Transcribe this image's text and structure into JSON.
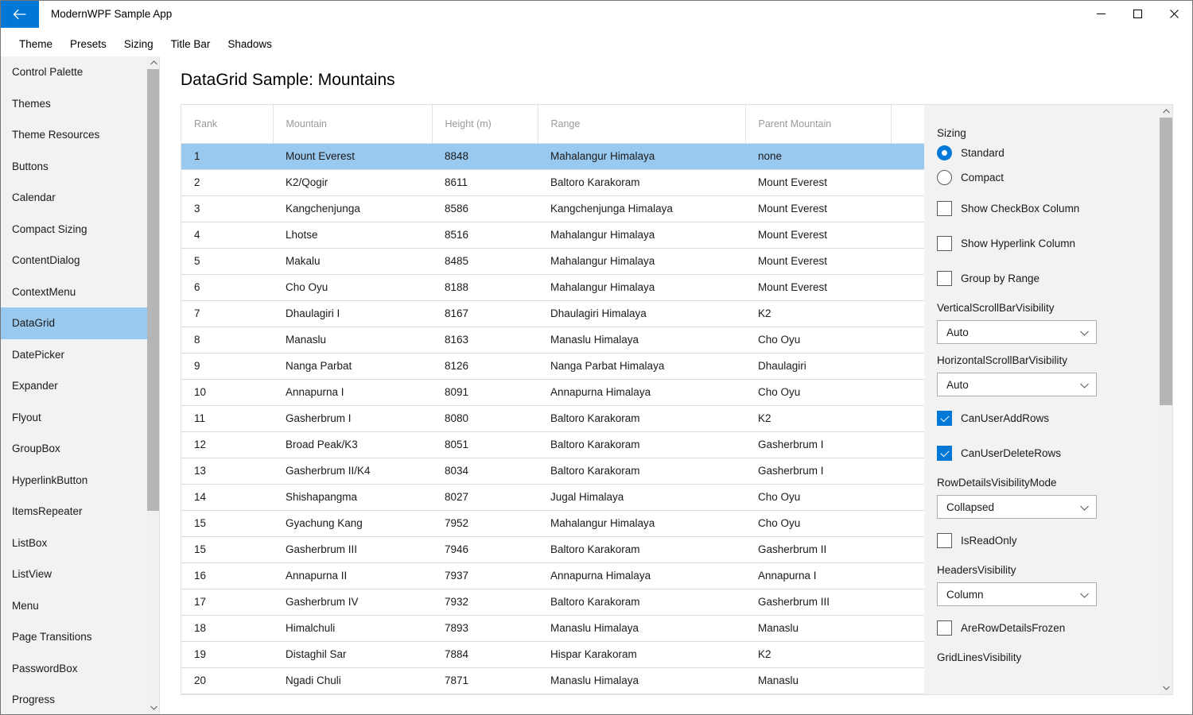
{
  "window": {
    "app_title": "ModernWPF Sample App",
    "back_icon": "back-arrow-icon",
    "minimize_label": "—",
    "maximize_label": "☐",
    "close_label": "✕"
  },
  "menubar": {
    "items": [
      {
        "label": "Theme"
      },
      {
        "label": "Presets"
      },
      {
        "label": "Sizing"
      },
      {
        "label": "Title Bar"
      },
      {
        "label": "Shadows"
      }
    ]
  },
  "sidebar": {
    "items": [
      {
        "label": "Control Palette",
        "selected": false
      },
      {
        "label": "Themes",
        "selected": false
      },
      {
        "label": "Theme Resources",
        "selected": false
      },
      {
        "label": "Buttons",
        "selected": false
      },
      {
        "label": "Calendar",
        "selected": false
      },
      {
        "label": "Compact Sizing",
        "selected": false
      },
      {
        "label": "ContentDialog",
        "selected": false
      },
      {
        "label": "ContextMenu",
        "selected": false
      },
      {
        "label": "DataGrid",
        "selected": true
      },
      {
        "label": "DatePicker",
        "selected": false
      },
      {
        "label": "Expander",
        "selected": false
      },
      {
        "label": "Flyout",
        "selected": false
      },
      {
        "label": "GroupBox",
        "selected": false
      },
      {
        "label": "HyperlinkButton",
        "selected": false
      },
      {
        "label": "ItemsRepeater",
        "selected": false
      },
      {
        "label": "ListBox",
        "selected": false
      },
      {
        "label": "ListView",
        "selected": false
      },
      {
        "label": "Menu",
        "selected": false
      },
      {
        "label": "Page Transitions",
        "selected": false
      },
      {
        "label": "PasswordBox",
        "selected": false
      },
      {
        "label": "Progress",
        "selected": false
      }
    ]
  },
  "main": {
    "page_title": "DataGrid Sample: Mountains"
  },
  "datagrid": {
    "columns": [
      "Rank",
      "Mountain",
      "Height (m)",
      "Range",
      "Parent Mountain",
      ""
    ],
    "rows": [
      {
        "rank": "1",
        "mountain": "Mount Everest",
        "height": "8848",
        "range": "Mahalangur Himalaya",
        "parent": "none",
        "selected": true
      },
      {
        "rank": "2",
        "mountain": "K2/Qogir",
        "height": "8611",
        "range": "Baltoro Karakoram",
        "parent": "Mount Everest",
        "selected": false
      },
      {
        "rank": "3",
        "mountain": "Kangchenjunga",
        "height": "8586",
        "range": "Kangchenjunga Himalaya",
        "parent": "Mount Everest",
        "selected": false
      },
      {
        "rank": "4",
        "mountain": "Lhotse",
        "height": "8516",
        "range": "Mahalangur Himalaya",
        "parent": "Mount Everest",
        "selected": false
      },
      {
        "rank": "5",
        "mountain": "Makalu",
        "height": "8485",
        "range": "Mahalangur Himalaya",
        "parent": "Mount Everest",
        "selected": false
      },
      {
        "rank": "6",
        "mountain": "Cho Oyu",
        "height": "8188",
        "range": "Mahalangur Himalaya",
        "parent": "Mount Everest",
        "selected": false
      },
      {
        "rank": "7",
        "mountain": "Dhaulagiri I",
        "height": "8167",
        "range": "Dhaulagiri Himalaya",
        "parent": "K2",
        "selected": false
      },
      {
        "rank": "8",
        "mountain": "Manaslu",
        "height": "8163",
        "range": "Manaslu Himalaya",
        "parent": "Cho Oyu",
        "selected": false
      },
      {
        "rank": "9",
        "mountain": "Nanga Parbat",
        "height": "8126",
        "range": "Nanga Parbat Himalaya",
        "parent": "Dhaulagiri",
        "selected": false
      },
      {
        "rank": "10",
        "mountain": "Annapurna I",
        "height": "8091",
        "range": "Annapurna Himalaya",
        "parent": "Cho Oyu",
        "selected": false
      },
      {
        "rank": "11",
        "mountain": "Gasherbrum I",
        "height": "8080",
        "range": "Baltoro Karakoram",
        "parent": "K2",
        "selected": false
      },
      {
        "rank": "12",
        "mountain": "Broad Peak/K3",
        "height": "8051",
        "range": "Baltoro Karakoram",
        "parent": "Gasherbrum I",
        "selected": false
      },
      {
        "rank": "13",
        "mountain": "Gasherbrum II/K4",
        "height": "8034",
        "range": "Baltoro Karakoram",
        "parent": "Gasherbrum I",
        "selected": false
      },
      {
        "rank": "14",
        "mountain": "Shishapangma",
        "height": "8027",
        "range": "Jugal Himalaya",
        "parent": "Cho Oyu",
        "selected": false
      },
      {
        "rank": "15",
        "mountain": "Gyachung Kang",
        "height": "7952",
        "range": "Mahalangur Himalaya",
        "parent": "Cho Oyu",
        "selected": false
      },
      {
        "rank": "15",
        "mountain": "Gasherbrum III",
        "height": "7946",
        "range": "Baltoro Karakoram",
        "parent": "Gasherbrum II",
        "selected": false
      },
      {
        "rank": "16",
        "mountain": "Annapurna II",
        "height": "7937",
        "range": "Annapurna Himalaya",
        "parent": "Annapurna I",
        "selected": false
      },
      {
        "rank": "17",
        "mountain": "Gasherbrum IV",
        "height": "7932",
        "range": "Baltoro Karakoram",
        "parent": "Gasherbrum III",
        "selected": false
      },
      {
        "rank": "18",
        "mountain": "Himalchuli",
        "height": "7893",
        "range": "Manaslu Himalaya",
        "parent": "Manaslu",
        "selected": false
      },
      {
        "rank": "19",
        "mountain": "Distaghil Sar",
        "height": "7884",
        "range": "Hispar Karakoram",
        "parent": "K2",
        "selected": false
      },
      {
        "rank": "20",
        "mountain": "Ngadi Chuli",
        "height": "7871",
        "range": "Manaslu Himalaya",
        "parent": "Manaslu",
        "selected": false
      }
    ]
  },
  "settings": {
    "sizing_label": "Sizing",
    "radio_standard": "Standard",
    "radio_compact": "Compact",
    "cb_show_checkbox_column": "Show CheckBox Column",
    "cb_show_hyperlink_column": "Show Hyperlink Column",
    "cb_group_by_range": "Group by Range",
    "vsb_label": "VerticalScrollBarVisibility",
    "vsb_value": "Auto",
    "hsb_label": "HorizontalScrollBarVisibility",
    "hsb_value": "Auto",
    "cb_can_user_add_rows": "CanUserAddRows",
    "cb_can_user_delete_rows": "CanUserDeleteRows",
    "rdvm_label": "RowDetailsVisibilityMode",
    "rdvm_value": "Collapsed",
    "cb_is_read_only": "IsReadOnly",
    "hv_label": "HeadersVisibility",
    "hv_value": "Column",
    "cb_are_row_details_frozen": "AreRowDetailsFrozen",
    "glv_label": "GridLinesVisibility"
  },
  "colors": {
    "accent": "#0078d7",
    "selection": "#9ac9ef",
    "sidebar_bg": "#f2f2f2",
    "panel_border": "#e2e2e2"
  }
}
